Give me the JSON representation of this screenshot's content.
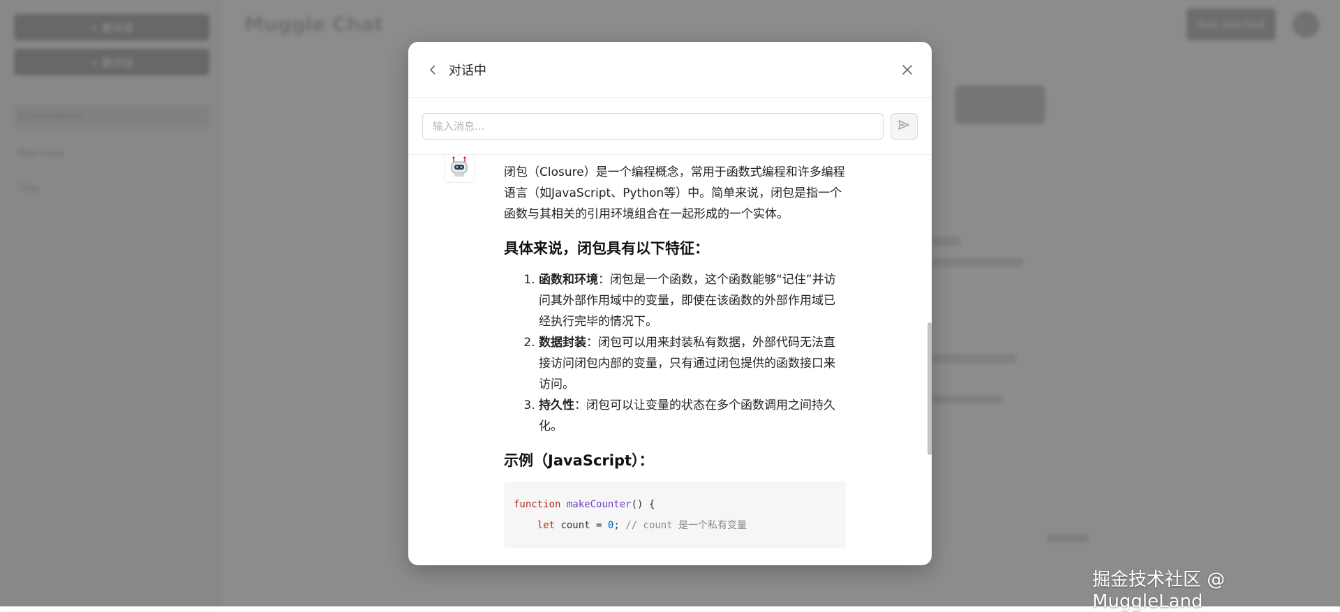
{
  "background": {
    "sidebar": {
      "new_chat_label": "+ 新对话",
      "second_button_label": "+ 新对话",
      "items": [
        "Conversation",
        "Fine-tune",
        "Title"
      ]
    },
    "app_title": "Muggle Chat",
    "login_label": "Get started"
  },
  "modal": {
    "title": "对话中",
    "input_placeholder": "输入消息..."
  },
  "message": {
    "intro": "闭包（Closure）是一个编程概念，常用于函数式编程和许多编程语言（如JavaScript、Python等）中。简单来说，闭包是指一个函数与其相关的引用环境组合在一起形成的一个实体。",
    "features_heading": "具体来说，闭包具有以下特征：",
    "features": [
      {
        "term": "函数和环境",
        "desc": "：闭包是一个函数，这个函数能够“记住”并访问其外部作用域中的变量，即使在该函数的外部作用域已经执行完毕的情况下。"
      },
      {
        "term": "数据封装",
        "desc": "：闭包可以用来封装私有数据，外部代码无法直接访问闭包内部的变量，只有通过闭包提供的函数接口来访问。"
      },
      {
        "term": "持久性",
        "desc": "：闭包可以让变量的状态在多个函数调用之间持久化。"
      }
    ],
    "example_heading": "示例（JavaScript）：",
    "code": {
      "line1_kw": "function",
      "line1_fn": "makeCounter",
      "line1_rest": "() {",
      "line2_kw": "let",
      "line2_var": " count = ",
      "line2_num": "0",
      "line2_rest": "; ",
      "line2_comment": "// count 是一个私有变量"
    }
  },
  "watermark": "掘金技术社区 @ MuggleLand",
  "icons": {
    "back": "chevron-left-icon",
    "close": "close-icon",
    "send": "send-icon",
    "bot": "robot-icon"
  }
}
